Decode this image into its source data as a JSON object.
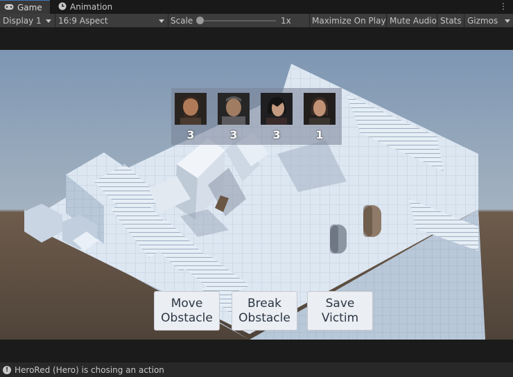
{
  "tabs": {
    "game_label": "Game",
    "animation_label": "Animation"
  },
  "toolbar": {
    "display": "Display 1",
    "aspect": "16:9 Aspect",
    "scale_label": "Scale",
    "scale_value": "1x",
    "maximize_on_play": "Maximize On Play",
    "mute_audio": "Mute Audio",
    "stats": "Stats",
    "gizmos": "Gizmos"
  },
  "heroes": [
    {
      "count": "3"
    },
    {
      "count": "3"
    },
    {
      "count": "3"
    },
    {
      "count": "1"
    }
  ],
  "actions": {
    "move_obstacle": "Move\nObstacle",
    "break_obstacle": "Break\nObstacle",
    "save_victim": "Save\nVictim"
  },
  "status": {
    "message": "HeroRed (Hero) is chosing an action"
  }
}
